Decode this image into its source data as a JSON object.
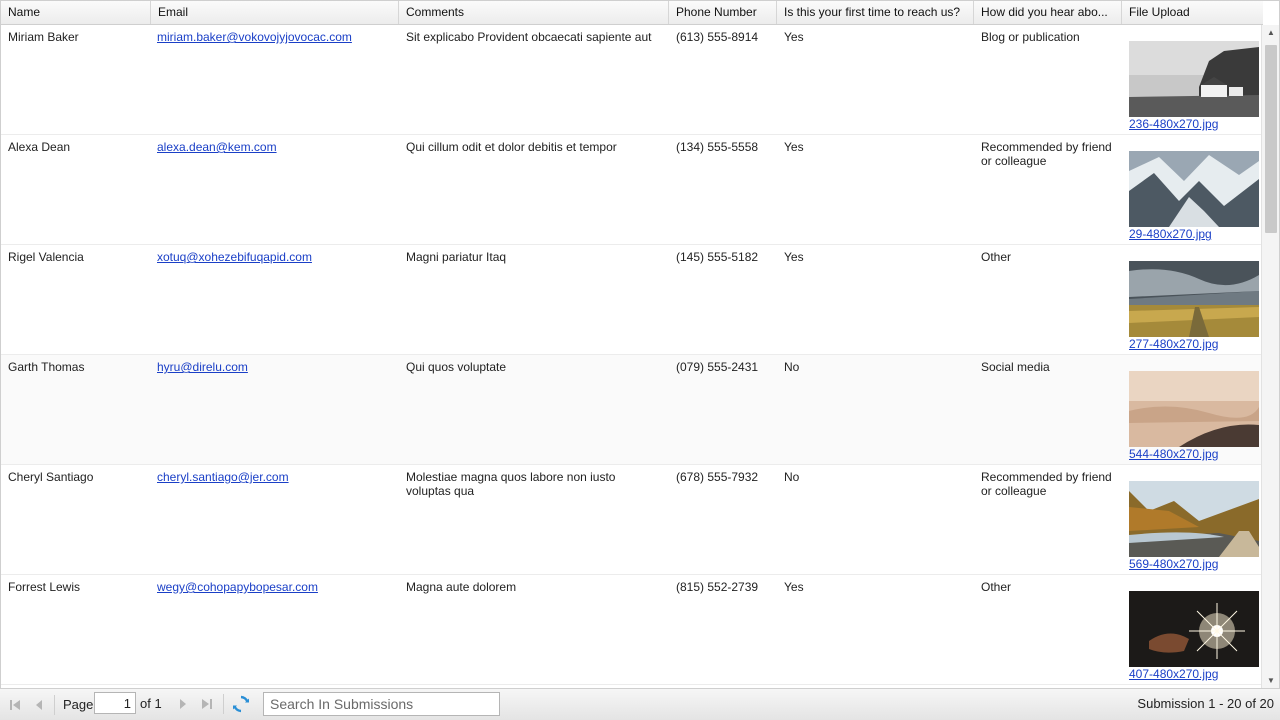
{
  "columns": [
    "Name",
    "Email",
    "Comments",
    "Phone Number",
    "Is this your first time to reach us?",
    "How did you hear abo...",
    "File Upload"
  ],
  "rows": [
    {
      "name": "Miriam Baker",
      "email": "miriam.baker@vokovojyjovocac.com",
      "comments": "Sit explicabo Provident obcaecati sapiente aut",
      "phone": "(613) 555-8914",
      "first_time": "Yes",
      "heard": "Blog or publication",
      "file": "236-480x270.jpg"
    },
    {
      "name": "Alexa Dean",
      "email": "alexa.dean@kem.com",
      "comments": "Qui cillum odit et dolor debitis et tempor",
      "phone": "(134) 555-5558",
      "first_time": "Yes",
      "heard": "Recommended by friend or colleague",
      "file": "29-480x270.jpg"
    },
    {
      "name": "Rigel Valencia",
      "email": "xotuq@xohezebifuqapid.com",
      "comments": "Magni pariatur Itaq",
      "phone": "(145) 555-5182",
      "first_time": "Yes",
      "heard": "Other",
      "file": "277-480x270.jpg"
    },
    {
      "name": "Garth Thomas",
      "email": "hyru@direlu.com",
      "comments": "Qui quos voluptate",
      "phone": "(079) 555-2431",
      "first_time": "No",
      "heard": "Social media",
      "file": "544-480x270.jpg"
    },
    {
      "name": "Cheryl Santiago",
      "email": "cheryl.santiago@jer.com",
      "comments": "Molestiae magna quos labore non iusto voluptas qua",
      "phone": "(678) 555-7932",
      "first_time": "No",
      "heard": "Recommended by friend or colleague",
      "file": "569-480x270.jpg"
    },
    {
      "name": "Forrest Lewis",
      "email": "wegy@cohopapybopesar.com",
      "comments": "Magna aute dolorem",
      "phone": "(815) 552-2739",
      "first_time": "Yes",
      "heard": "Other",
      "file": "407-480x270.jpg"
    }
  ],
  "toolbar": {
    "page_label": "Page",
    "page_value": "1",
    "of_label": "of 1",
    "search_placeholder": "Search In Submissions",
    "summary": "Submission 1 - 20 of 20"
  },
  "icons": {
    "first": "first-page-icon",
    "prev": "previous-page-icon",
    "next": "next-page-icon",
    "last": "last-page-icon",
    "refresh": "refresh-icon"
  },
  "colors": {
    "link": "#1a3fc7",
    "refresh": "#2a8fd6"
  }
}
